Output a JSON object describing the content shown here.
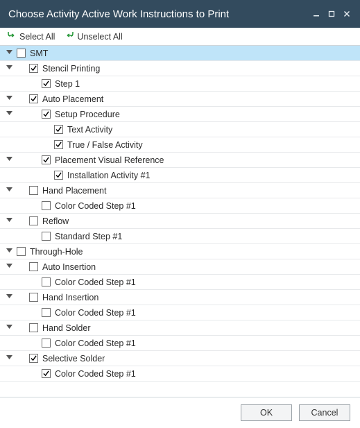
{
  "window": {
    "title": "Choose Activity Active Work Instructions to Print"
  },
  "toolbar": {
    "select_all": "Select All",
    "unselect_all": "Unselect All"
  },
  "footer": {
    "ok": "OK",
    "cancel": "Cancel"
  },
  "colors": {
    "titlebar_bg": "#334b5e",
    "selection_bg": "#bfe4f9",
    "arrow_green": "#2e9b3f"
  },
  "tree": {
    "rows": [
      {
        "indent": 0,
        "expander": true,
        "checked": false,
        "label": "SMT",
        "selected": true
      },
      {
        "indent": 1,
        "expander": true,
        "checked": true,
        "label": "Stencil Printing"
      },
      {
        "indent": 2,
        "expander": false,
        "checked": true,
        "label": "Step 1"
      },
      {
        "indent": 1,
        "expander": true,
        "checked": true,
        "label": "Auto Placement"
      },
      {
        "indent": 2,
        "expander": true,
        "checked": true,
        "label": "Setup Procedure"
      },
      {
        "indent": 3,
        "expander": false,
        "checked": true,
        "label": "Text Activity"
      },
      {
        "indent": 3,
        "expander": false,
        "checked": true,
        "label": "True / False Activity"
      },
      {
        "indent": 2,
        "expander": true,
        "checked": true,
        "label": "Placement Visual Reference"
      },
      {
        "indent": 3,
        "expander": false,
        "checked": true,
        "label": "Installation Activity #1"
      },
      {
        "indent": 1,
        "expander": true,
        "checked": false,
        "label": "Hand Placement"
      },
      {
        "indent": 2,
        "expander": false,
        "checked": false,
        "label": "Color Coded Step #1"
      },
      {
        "indent": 1,
        "expander": true,
        "checked": false,
        "label": "Reflow"
      },
      {
        "indent": 2,
        "expander": false,
        "checked": false,
        "label": "Standard Step #1"
      },
      {
        "indent": 0,
        "expander": true,
        "checked": false,
        "label": "Through-Hole"
      },
      {
        "indent": 1,
        "expander": true,
        "checked": false,
        "label": "Auto Insertion"
      },
      {
        "indent": 2,
        "expander": false,
        "checked": false,
        "label": "Color Coded Step #1"
      },
      {
        "indent": 1,
        "expander": true,
        "checked": false,
        "label": "Hand Insertion"
      },
      {
        "indent": 2,
        "expander": false,
        "checked": false,
        "label": "Color Coded Step #1"
      },
      {
        "indent": 1,
        "expander": true,
        "checked": false,
        "label": "Hand Solder"
      },
      {
        "indent": 2,
        "expander": false,
        "checked": false,
        "label": "Color Coded Step #1"
      },
      {
        "indent": 1,
        "expander": true,
        "checked": true,
        "label": "Selective Solder"
      },
      {
        "indent": 2,
        "expander": false,
        "checked": true,
        "label": "Color Coded Step #1"
      }
    ]
  }
}
